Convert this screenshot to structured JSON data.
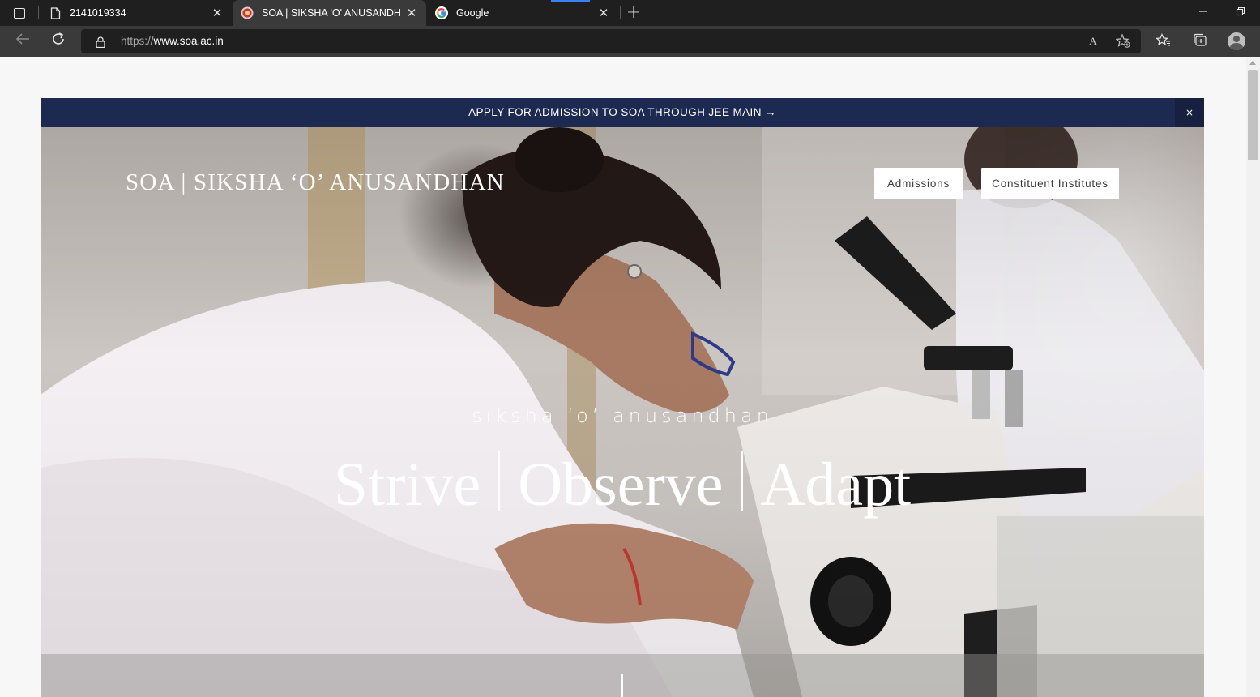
{
  "browser": {
    "tabs": [
      {
        "title": "2141019334",
        "icon": "document-icon",
        "close": "✕"
      },
      {
        "title": "SOA | SIKSHA 'O' ANUSANDHAN",
        "icon": "soa-favicon",
        "close": "✕"
      },
      {
        "title": "Google",
        "icon": "google-favicon",
        "close": "✕"
      }
    ],
    "new_tab": "+",
    "address": {
      "scheme": "https://",
      "host": "www.soa.ac.in"
    },
    "read_aloud_label": "A",
    "accent": "#3b82f6"
  },
  "page": {
    "announcement": {
      "text": "APPLY FOR ADMISSION TO SOA THROUGH JEE MAIN →",
      "close": "×",
      "background": "#1c2951"
    },
    "brand": "SOA | SIKSHA ‘O’ ANUSANDHAN",
    "nav": {
      "admissions": "Admissions",
      "constituent_institutes": "Constituent Institutes"
    },
    "hero": {
      "tagline": "siksha ‘o’ anusandhan",
      "motto": [
        "Strive",
        "Observe",
        "Adapt"
      ]
    }
  }
}
